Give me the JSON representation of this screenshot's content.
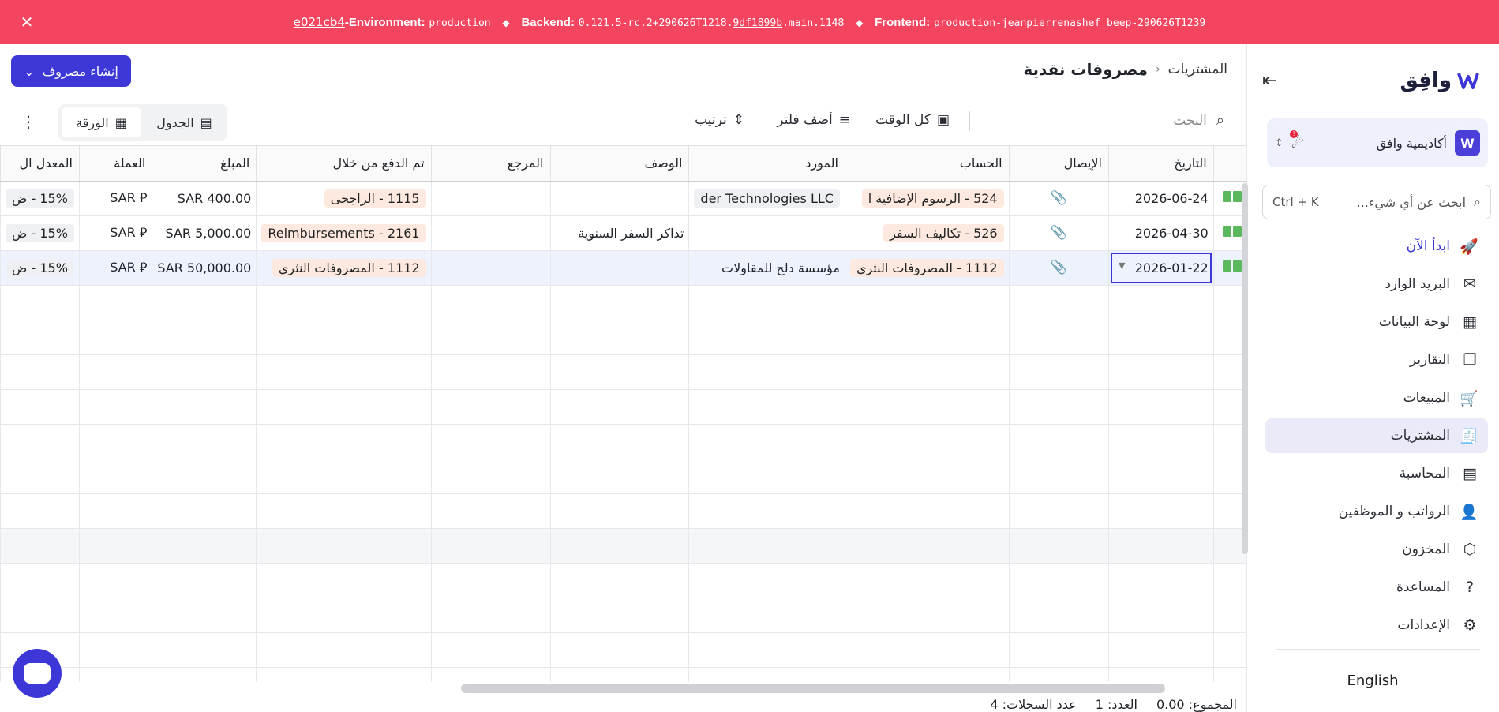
{
  "banner": {
    "commit": "e021cb4",
    "env_label": "-Environment:",
    "env_value": "production",
    "backend_label": "Backend:",
    "backend_prefix": "0.121.5-rc.2+290626T1218.",
    "backend_hash": "9df1899b",
    "backend_suffix": ".main.1148",
    "frontend_label": "Frontend:",
    "frontend_value": "production-jeanpierrenashef_beep-290626T1239",
    "close": "✕"
  },
  "sidebar": {
    "logo": "وافِق",
    "academy": "أكاديمية وافق",
    "academy_badge": "!",
    "search_placeholder": "ابحث عن أي شيء...",
    "search_shortcut": "Ctrl + K",
    "items": [
      {
        "label": "ابدأ الآن",
        "icon": "rocket-icon"
      },
      {
        "label": "البريد الوارد",
        "icon": "inbox-icon"
      },
      {
        "label": "لوحة البيانات",
        "icon": "dashboard-icon"
      },
      {
        "label": "التقارير",
        "icon": "reports-icon"
      },
      {
        "label": "المبيعات",
        "icon": "cart-icon"
      },
      {
        "label": "المشتريات",
        "icon": "receipt-icon"
      },
      {
        "label": "المحاسبة",
        "icon": "ledger-icon"
      },
      {
        "label": "الرواتب و الموظفين",
        "icon": "users-icon"
      },
      {
        "label": "المخزون",
        "icon": "box-icon"
      },
      {
        "label": "المساعدة",
        "icon": "help-icon"
      },
      {
        "label": "الإعدادات",
        "icon": "gear-icon"
      }
    ],
    "language": "English"
  },
  "header": {
    "breadcrumb_parent": "المشتريات",
    "title": "مصروفات نقدية",
    "create_button": "إنشاء مصروف"
  },
  "toolbar": {
    "search_placeholder": "البحث",
    "time_filter": "كل الوقت",
    "add_filter": "أضف فلتر",
    "sort": "ترتيب",
    "view_table": "الجدول",
    "view_sheet": "الورقة"
  },
  "table": {
    "columns": [
      "",
      "التاريخ",
      "الإيصال",
      "الحساب",
      "المورد",
      "الوصف",
      "المرجع",
      "تم الدفع من خلال",
      "المبلغ",
      "العملة",
      "المعدل ال"
    ],
    "rows": [
      {
        "date": "2026-06-24",
        "account": "524 - الرسوم الإضافية ا",
        "vendor": "der Technologies LLC",
        "description": "",
        "reference": "",
        "paid_through": "1115 - الراجحى",
        "amount": "SAR 400.00",
        "currency": "SAR",
        "rate": "15% - ض"
      },
      {
        "date": "2026-04-30",
        "account": "526 - تكاليف السفر",
        "vendor": "",
        "description": "تذاكر السفر السنوية",
        "reference": "",
        "paid_through": "2161 - Reimbursements",
        "amount": "SAR 5,000.00",
        "currency": "SAR",
        "rate": "15% - ض"
      },
      {
        "date": "2026-01-22",
        "account": "1112 - المصروفات النثري",
        "vendor": "مؤسسة دلج للمقاولات",
        "description": "",
        "reference": "",
        "paid_through": "1112 - المصروفات النثري",
        "amount": "SAR 50,000.00",
        "currency": "SAR",
        "rate": "15% - ض"
      }
    ],
    "currency_symbol": "⃁"
  },
  "footer": {
    "total": "المجموع: 0.00",
    "count": "العدد: 1",
    "records": "عدد السجلات: 4"
  },
  "colors": {
    "banner": "#f3455f",
    "accent": "#3c37d6",
    "pill": "#fde9df",
    "book": "#5cb85c"
  }
}
